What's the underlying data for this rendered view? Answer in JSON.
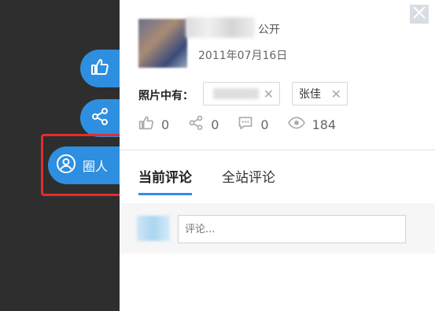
{
  "colors": {
    "accent": "#2e8fe0",
    "highlight": "#e52c2c",
    "dark": "#2e2e2e"
  },
  "sidebar": {
    "like_icon": "thumbs-up-icon",
    "share_icon": "share-icon",
    "circle_icon": "user-circle-icon",
    "circle_label": "圈人"
  },
  "photo": {
    "privacy": "公开",
    "date": "2011年07月16日",
    "tagged_label": "照片中有：",
    "tags": [
      {
        "name": ""
      },
      {
        "name": "张佳"
      }
    ]
  },
  "stats": {
    "likes": "0",
    "shares": "0",
    "comments": "0",
    "views": "184"
  },
  "tabs": [
    {
      "label": "当前评论",
      "active": true
    },
    {
      "label": "全站评论",
      "active": false
    }
  ],
  "comment": {
    "placeholder": "评论..."
  }
}
